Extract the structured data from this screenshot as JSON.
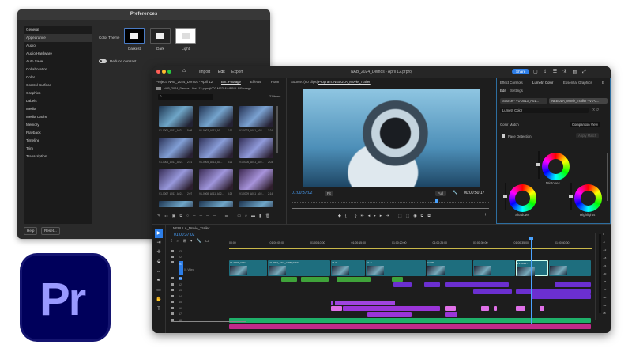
{
  "preferences": {
    "title": "Preferences",
    "items": [
      "General",
      "Appearance",
      "Audio",
      "Audio Hardware",
      "Auto Save",
      "Collaboration",
      "Color",
      "Control Surface",
      "Graphics",
      "Labels",
      "Media",
      "Media Cache",
      "Memory",
      "Playback",
      "Timeline",
      "Trim",
      "Transcription"
    ],
    "selected": 1,
    "color_theme_label": "Color Theme",
    "themes": [
      "Darkest",
      "Dark",
      "Light"
    ],
    "reduce_contrast": "Reduce contrast",
    "help": "Help",
    "reset": "Reset..."
  },
  "app_icon": "Pr",
  "main": {
    "nav": [
      "Import",
      "Edit",
      "Export"
    ],
    "title": "NAB_2024_Demos - April 12.prproj",
    "share": "Share",
    "project": {
      "tabs": [
        "Project: NAB_2024_Demos - April 12",
        "Bin: Footage",
        "Effects",
        "Fram"
      ],
      "path": "NAB_2024_Demos - April 12.prproj\\002 MEDIA\\NEBULA\\Footage",
      "count": "21 items",
      "items": [
        {
          "name": "V1-0001_A011_A02...",
          "dur": "5:08"
        },
        {
          "name": "V1-0002_A011_A0...",
          "dur": "7:10"
        },
        {
          "name": "V1-0003_A011_A02...",
          "dur": "3:24"
        },
        {
          "name": "V1-0004_A011_A02...",
          "dur": "2:21"
        },
        {
          "name": "V1-0005_A011_A0...",
          "dur": "3:21"
        },
        {
          "name": "V1-0006_A011_A02...",
          "dur": "2:03"
        },
        {
          "name": "V1-0007_A011_A02...",
          "dur": "2:07"
        },
        {
          "name": "V1-0008_A011_A02...",
          "dur": "3:29"
        },
        {
          "name": "V1-0009_A011_A02...",
          "dur": "2:14"
        }
      ]
    },
    "monitor": {
      "source_tab": "Source: (no clips)",
      "program_tab": "Program: NEBULA_Movie_Trailer",
      "timecode": "01:00:37:02",
      "fit": "Fit",
      "quality": "Full",
      "duration": "00:00:50:17"
    },
    "lumetri": {
      "tabs": [
        "Effect Controls",
        "Lumetri Color",
        "Essential Graphics",
        "E"
      ],
      "subtabs": [
        "Edit",
        "Settings"
      ],
      "source": "Source - V1-0013_A01...",
      "sequence": "NEBULA_Movie_Trailer - V1-0...",
      "effect": "Lumetri Color",
      "color_match": "Color Match",
      "comparison": "Comparison View",
      "face_detection": "Face Detection",
      "apply_match": "Apply Match",
      "wheels": [
        "Midtones",
        "Shadows",
        "Highlights"
      ]
    },
    "timeline": {
      "tab": "NEBULA_Movie_Trailer",
      "timecode": "01:00:37:02",
      "ruler": [
        "00:00",
        "01:00:05:00",
        "01:00:10:00",
        "01:00:15:00",
        "01:00:20:00",
        "01:00:25:00",
        "01:00:30:00",
        "01:00:35:00",
        "01:00:40:00"
      ],
      "playhead_seconds": 37.1,
      "video_tracks": [
        "V3",
        "V2",
        "V1"
      ],
      "v1_name": "01 Video",
      "audio_tracks": [
        "A1",
        "A2",
        "A3",
        "A4",
        "A5",
        "A6",
        "A7",
        "A8"
      ],
      "meter_ticks": [
        "0",
        "-6",
        "-12",
        "-18",
        "-24",
        "-30",
        "-36",
        "-42",
        "-48",
        "-54",
        "dB"
      ],
      "v1_clips": [
        {
          "label": "V1-0001_A011...",
          "start": 0,
          "end": 4.8
        },
        {
          "label": "V1-0002_A011_A005_01102...",
          "start": 4.8,
          "end": 12.5
        },
        {
          "label": "V1-0...",
          "start": 12.5,
          "end": 16.8
        },
        {
          "label": "V1-0...",
          "start": 16.8,
          "end": 24.3
        },
        {
          "label": "V1-00...",
          "start": 24.3,
          "end": 30
        },
        {
          "label": "",
          "start": 30,
          "end": 35.2
        },
        {
          "label": "V1-0013...",
          "start": 35.2,
          "end": 39.3
        },
        {
          "label": "",
          "start": 39.3,
          "end": 44.6
        }
      ],
      "audio_clips": [
        {
          "track": 0,
          "start": 6.4,
          "end": 8.4,
          "color": "#3fa33a"
        },
        {
          "track": 0,
          "start": 8.8,
          "end": 12.3,
          "color": "#3fa33a"
        },
        {
          "track": 0,
          "start": 13.2,
          "end": 17.5,
          "color": "#3fa33a"
        },
        {
          "track": 0,
          "start": 20,
          "end": 21.5,
          "color": "#3fa33a"
        },
        {
          "track": 1,
          "start": 20.2,
          "end": 22.5,
          "color": "#6b2fd0"
        },
        {
          "track": 1,
          "start": 24,
          "end": 26,
          "color": "#6b2fd0"
        },
        {
          "track": 1,
          "start": 26.5,
          "end": 34.5,
          "color": "#6b2fd0"
        },
        {
          "track": 1,
          "start": 40,
          "end": 44.6,
          "color": "#6b2fd0"
        },
        {
          "track": 2,
          "start": 30,
          "end": 34.9,
          "color": "#6b2fd0"
        },
        {
          "track": 2,
          "start": 35.2,
          "end": 44.6,
          "color": "#6b2fd0"
        },
        {
          "track": 3,
          "start": 37.2,
          "end": 44.6,
          "color": "#6b2fd0"
        },
        {
          "track": 4,
          "start": 12.5,
          "end": 12.9,
          "color": "#a044e0"
        },
        {
          "track": 4,
          "start": 13,
          "end": 20.5,
          "color": "#a044e0"
        },
        {
          "track": 5,
          "start": 12.5,
          "end": 14,
          "color": "#e070e8"
        },
        {
          "track": 5,
          "start": 14,
          "end": 26,
          "color": "#9a35d8"
        },
        {
          "track": 5,
          "start": 26.5,
          "end": 28,
          "color": "#e070e8"
        },
        {
          "track": 5,
          "start": 31,
          "end": 32,
          "color": "#e070e8"
        },
        {
          "track": 5,
          "start": 32.5,
          "end": 33,
          "color": "#e070e8"
        },
        {
          "track": 5,
          "start": 35.2,
          "end": 36.5,
          "color": "#e070e8"
        },
        {
          "track": 5,
          "start": 38.2,
          "end": 38.8,
          "color": "#e070e8"
        },
        {
          "track": 6,
          "start": 17,
          "end": 22.5,
          "color": "#9a35d8"
        },
        {
          "track": 6,
          "start": 26.5,
          "end": 28.2,
          "color": "#9a35d8"
        },
        {
          "track": 7,
          "start": 0,
          "end": 44.6,
          "color": "#1fb06a"
        },
        {
          "track": 8,
          "start": 0,
          "end": 44.6,
          "color": "#c02a8a"
        }
      ]
    },
    "colors": {
      "accent": "#2d7ee8",
      "timecode": "#4aa3ff",
      "clip_video": "#1e6e7e"
    }
  }
}
